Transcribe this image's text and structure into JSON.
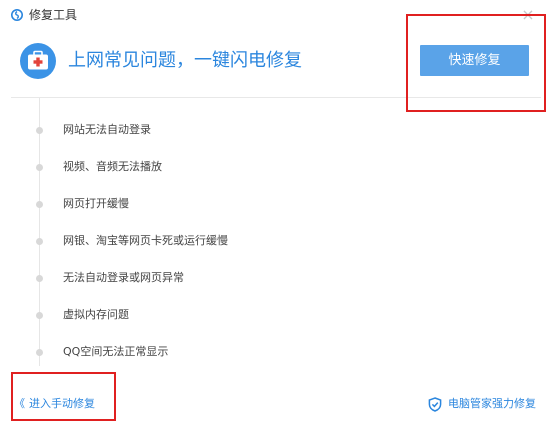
{
  "window": {
    "title": "修复工具",
    "close_glyph": "×"
  },
  "hero": {
    "icon": "first-aid-kit-icon",
    "headline": "上网常见问题，一键闪电修复",
    "accent_color": "#2b86de"
  },
  "actions": {
    "quick_fix_label": "快速修复",
    "quick_fix_color": "#5aa3e8"
  },
  "issues": [
    "网站无法自动登录",
    "视频、音频无法播放",
    "网页打开缓慢",
    "网银、淘宝等网页卡死或运行缓慢",
    "无法自动登录或网页异常",
    "虚拟内存问题",
    "QQ空间无法正常显示"
  ],
  "footer": {
    "manual_chevron": "《",
    "manual_label": "进入手动修复",
    "pcmgr_icon": "shield-check-icon",
    "pcmgr_label": "电脑管家强力修复"
  },
  "annotation_color": "#e02020"
}
